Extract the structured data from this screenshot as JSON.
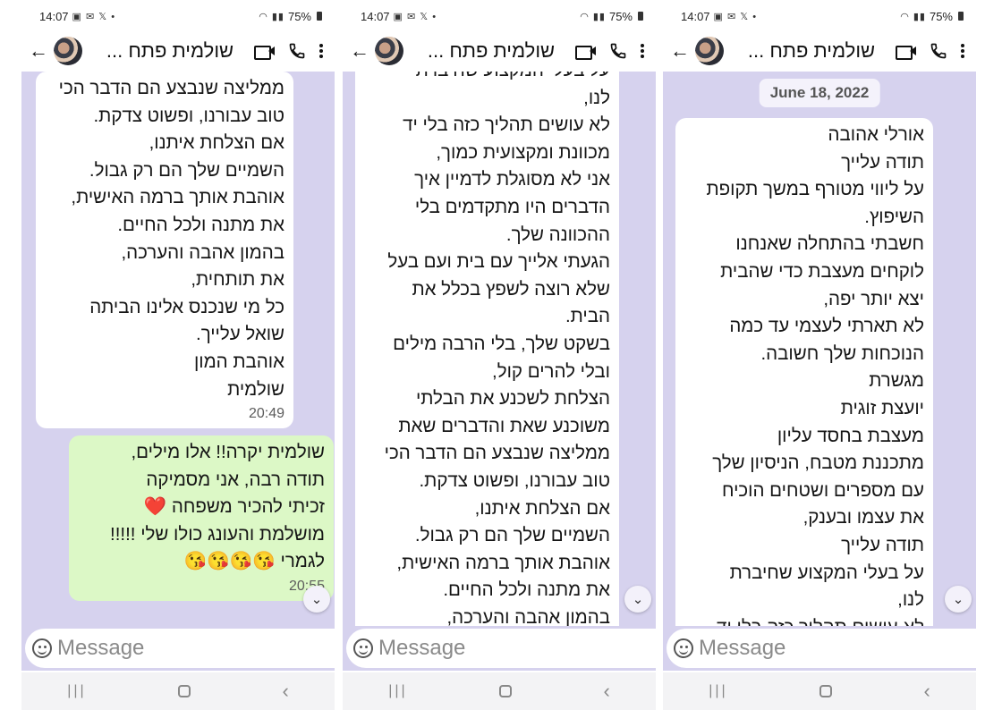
{
  "status": {
    "time": "14:07",
    "battery": "75%"
  },
  "header": {
    "contact_name": "שולמית פתח ..."
  },
  "composer": {
    "placeholder": "Message"
  },
  "panels": [
    {
      "messages": [
        {
          "dir": "in",
          "lines": [
            "ממליצה שנבצע הם הדבר הכי",
            "טוב עבורנו, ופשוט צדקת.",
            "אם הצלחת איתנו,",
            "השמיים שלך הם רק גבול.",
            "אוהבת אותך ברמה האישית,",
            "את מתנה ולכל החיים.",
            "בהמון אהבה והערכה,",
            "את תותחית,",
            "כל מי שנכנס אלינו הביתה",
            "שואל עלייך.",
            "אוהבת המון",
            "שולמית"
          ],
          "time": "20:49"
        },
        {
          "dir": "out",
          "lines": [
            "שולמית יקרה!! אלו מילים,",
            "תודה רבה, אני מסמיקה",
            "זכיתי להכיר משפחה ❤️",
            "מושלמת והעונג כולו שלי !!!!!",
            "לגמרי 😘😘😘😘"
          ],
          "time": "20:55"
        }
      ]
    },
    {
      "messages": [
        {
          "dir": "in",
          "lines": [
            "על בעלי המקצוע שחיברת",
            "לנו,",
            "לא עושים תהליך כזה בלי יד",
            "מכוונת ומקצועית כמוך,",
            "אני לא מסוגלת לדמיין איך",
            "הדברים היו מתקדמים בלי",
            "ההכוונה שלך.",
            "הגעתי אלייך עם בית ועם בעל",
            "שלא רוצה לשפץ בכלל את",
            "הבית.",
            "בשקט שלך, בלי הרבה מילים",
            "ובלי להרים קול,",
            "הצלחת לשכנע את הבלתי",
            "משוכנע שאת והדברים שאת",
            "ממליצה שנבצע הם הדבר הכי",
            "טוב עבורנו, ופשוט צדקת.",
            "אם הצלחת איתנו,",
            "השמיים שלך הם רק גבול.",
            "אוהבת אותך ברמה האישית,",
            "את מתנה ולכל החיים.",
            "בהמון אהבה והערכה,"
          ],
          "time": ""
        }
      ]
    },
    {
      "date_chip": "June 18, 2022",
      "messages": [
        {
          "dir": "in",
          "lines": [
            "אורלי אהובה",
            "תודה עלייך",
            "על ליווי מטורף במשך תקופת",
            "השיפוץ.",
            "חשבתי בהתחלה שאנחנו",
            "לוקחים מעצבת כדי שהבית",
            "יצא יותר יפה,",
            "לא תארתי לעצמי עד כמה",
            "הנוכחות שלך חשובה.",
            "מגשרת",
            "יועצת זוגית",
            "מעצבת בחסד עליון",
            "מתכננת מטבח, הניסיון שלך",
            "עם מספרים ושטחים הוכיח",
            "את עצמו ובענק,",
            "תודה עלייך",
            "על בעלי המקצוע שחיברת",
            "לנו,",
            "לא עושים תהליך כזה בלי יד"
          ],
          "time": ""
        }
      ]
    }
  ]
}
